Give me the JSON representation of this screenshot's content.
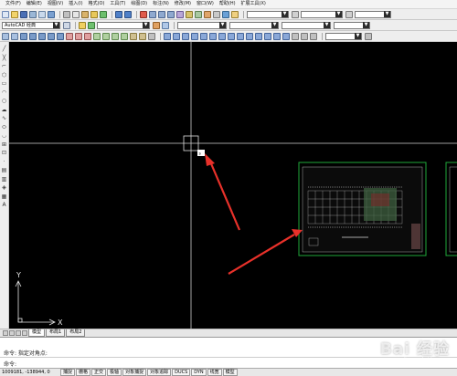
{
  "menubar": {
    "items": [
      "文件(F)",
      "编辑(E)",
      "视图(V)",
      "插入(I)",
      "格式(O)",
      "工具(T)",
      "绘图(D)",
      "标注(N)",
      "修改(M)",
      "窗口(W)",
      "帮助(H)",
      "扩展工具(X)"
    ]
  },
  "toolbar2": {
    "workspace_value": "AutoCAD 经典"
  },
  "layout_tabs": [
    "模型",
    "布局1",
    "布局2"
  ],
  "command": {
    "line1": "命令: 指定对角点:",
    "line2": "命令:"
  },
  "statusbar": {
    "coords": "1009181, -138944, 0",
    "buttons": [
      "捕捉",
      "栅格",
      "正交",
      "极轴",
      "对象捕捉",
      "对象追踪",
      "DUCS",
      "DYN",
      "线宽",
      "模型"
    ]
  },
  "canvas": {
    "ucs_x_label": "X",
    "ucs_y_label": "Y"
  },
  "watermark": {
    "text": "Bai 经验",
    "url": "jingyan.baidu.com"
  },
  "colors": {
    "canvas_bg": "#000000",
    "crosshair": "#ffffff",
    "arrow": "#e8312a",
    "drawing_border": "#1fa83a"
  }
}
